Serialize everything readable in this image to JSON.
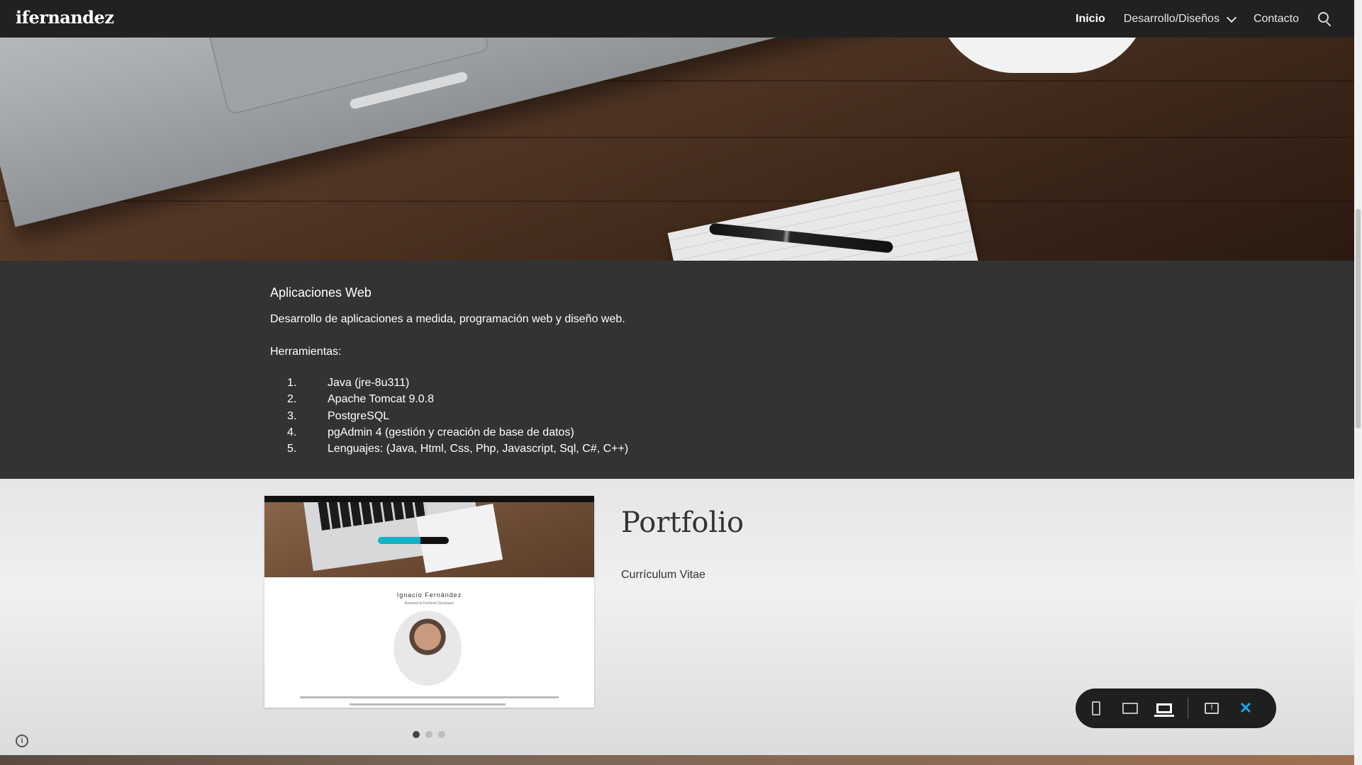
{
  "header": {
    "logo": "ifernandez",
    "nav": [
      {
        "label": "Inicio"
      },
      {
        "label": "Desarrollo/Diseños"
      },
      {
        "label": "Contacto"
      }
    ],
    "search_icon": "search-icon"
  },
  "web_section": {
    "title": "Aplicaciones Web",
    "description": "Desarrollo de aplicaciones a medida, programación web y diseño web.",
    "tools_label": "Herramientas:",
    "tools": [
      {
        "num": "1.",
        "text": "Java (jre-8u311)"
      },
      {
        "num": "2.",
        "text": "Apache Tomcat 9.0.8"
      },
      {
        "num": "3.",
        "text": "PostgreSQL"
      },
      {
        "num": "4.",
        "text": "pgAdmin 4 (gestión y creación de base de datos)"
      },
      {
        "num": "5.",
        "text": "Lenguajes: (Java, Html, Css, Php, Javascript, Sql, C#, C++)"
      }
    ]
  },
  "portfolio": {
    "title": "Portfolio",
    "subtitle": "Currículum Vitae",
    "preview_name": "Ignacio Fernández",
    "preview_subtitle": "Backend & Frontend Developer"
  },
  "colors": {
    "topbar": "#212121",
    "dark_section": "#323335",
    "accent_close": "#19a6e6"
  }
}
